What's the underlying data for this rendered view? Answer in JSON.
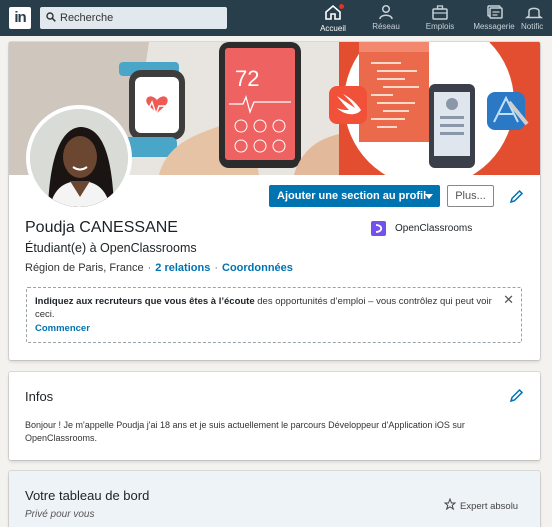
{
  "nav": {
    "logo_text": "in",
    "search_placeholder": "Recherche",
    "items": [
      {
        "label": "Accueil",
        "icon": "home-icon"
      },
      {
        "label": "Réseau",
        "icon": "network-icon"
      },
      {
        "label": "Emplois",
        "icon": "briefcase-icon"
      },
      {
        "label": "Messagerie",
        "icon": "messaging-icon"
      },
      {
        "label": "Notific",
        "icon": "bell-icon"
      }
    ]
  },
  "banner": {
    "watch_value": "72",
    "colors": {
      "background": "#e24e2f",
      "swift": "#f05138"
    }
  },
  "profile": {
    "add_section_label": "Ajouter une section au profil",
    "more_label": "Plus...",
    "name": "Poudja CANESSANE",
    "headline": "Étudiant(e) à OpenClassrooms",
    "location": "Région de Paris, France",
    "relations": "2 relations",
    "contact_link": "Coordonnées",
    "company": "OpenClassrooms"
  },
  "notice": {
    "bold_text": "Indiquez aux recruteurs que vous êtes à l’écoute",
    "rest_text": " des opportunités d’emploi – vous contrôlez qui peut voir ceci.",
    "cta": "Commencer",
    "close": "✕"
  },
  "infos": {
    "title": "Infos",
    "text": "Bonjour ! Je m'appelle Poudja j'ai 18 ans et je suis actuellement le parcours Développeur d'Application iOS sur OpenClassrooms."
  },
  "dashboard": {
    "title": "Votre tableau de bord",
    "subtitle": "Privé pour vous",
    "badge": "Expert absolu"
  },
  "colors": {
    "nav_bg": "#283e4a",
    "primary_blue": "#0073b1",
    "page_bg": "#f3f2ef"
  }
}
